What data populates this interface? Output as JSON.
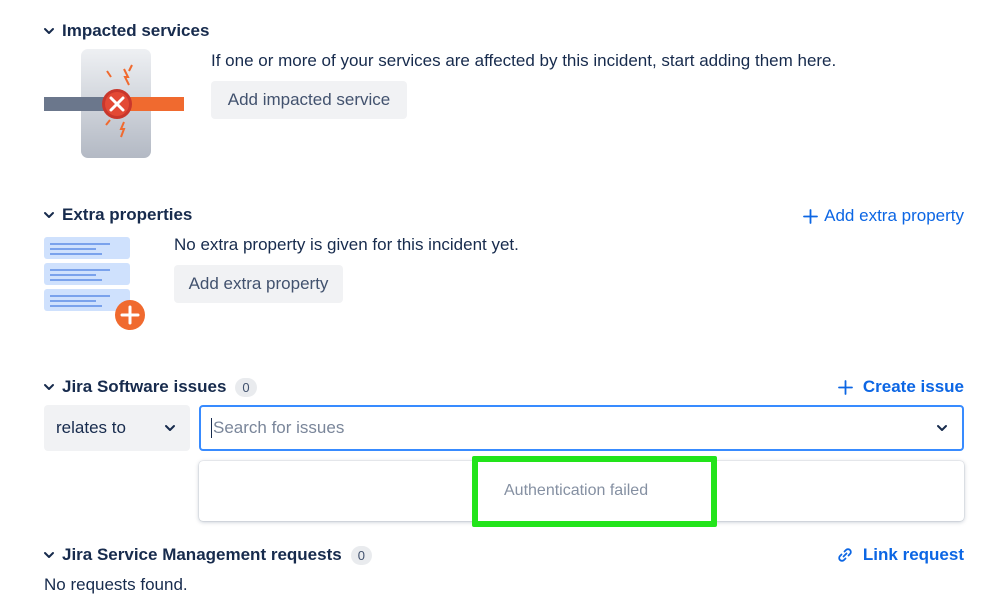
{
  "impacted": {
    "title": "Impacted services",
    "description": "If one or more of your services are affected by this incident, start adding them here.",
    "button": "Add impacted service"
  },
  "extra": {
    "title": "Extra properties",
    "add_link": "Add extra property",
    "description": "No extra property is given for this incident yet.",
    "button": "Add extra property"
  },
  "jira_software": {
    "title": "Jira Software issues",
    "count": "0",
    "create_link": "Create issue",
    "relation": "relates to",
    "search_placeholder": "Search for issues",
    "dropdown_message": "Authentication failed"
  },
  "jsm": {
    "title": "Jira Service Management requests",
    "count": "0",
    "link": "Link request",
    "empty": "No requests found."
  },
  "colors": {
    "link": "#0c66e4",
    "focus_border": "#388bff",
    "highlight": "#22e41a",
    "accent_orange": "#f06a2f"
  }
}
